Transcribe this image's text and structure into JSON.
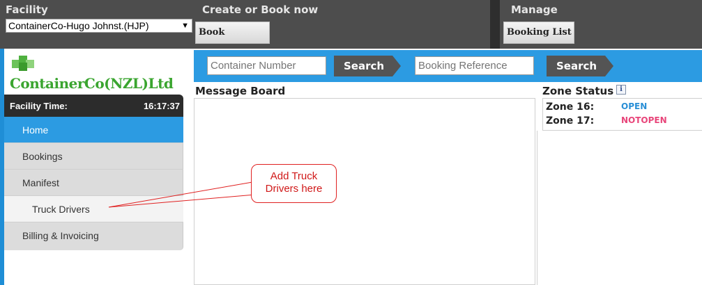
{
  "header": {
    "facility_label": "Facility",
    "facility_value": "ContainerCo-Hugo Johnst.(HJP)",
    "create_label": "Create or Book now",
    "book_button": "Book",
    "manage_label": "Manage",
    "booking_list_button": "Booking List"
  },
  "logo": {
    "text": "ContainerCo(NZL)Ltd",
    "brand_color": "#3aa52f"
  },
  "facility_time": {
    "label": "Facility Time:",
    "value": "16:17:37"
  },
  "sidebar": {
    "items": [
      {
        "label": "Home",
        "active": true
      },
      {
        "label": "Bookings"
      },
      {
        "label": "Manifest"
      },
      {
        "label": "Truck Drivers",
        "sub": true
      },
      {
        "label": "Billing & Invoicing"
      }
    ]
  },
  "search": {
    "container_placeholder": "Container Number",
    "container_button": "Search",
    "booking_placeholder": "Booking Reference",
    "booking_button": "Search"
  },
  "message_board": {
    "title": "Message Board"
  },
  "zone_status": {
    "title": "Zone Status",
    "info_icon": "i",
    "zones": [
      {
        "label": "Zone 16:",
        "status": "OPEN",
        "color": "#2a8fd6"
      },
      {
        "label": "Zone 17:",
        "status": "NOTOPEN",
        "color": "#e8457a"
      }
    ]
  },
  "callout": {
    "line1": "Add Truck",
    "line2": "Drivers here",
    "color": "#e02020"
  },
  "colors": {
    "accent_blue": "#2c9be2",
    "header_dark": "#4d4d4d"
  }
}
